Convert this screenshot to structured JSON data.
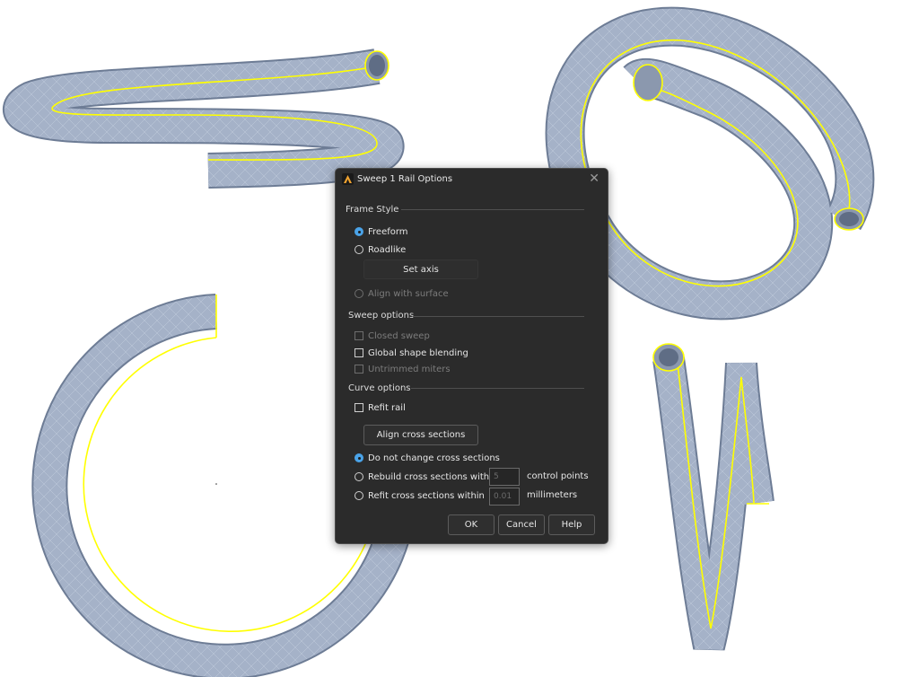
{
  "dialog": {
    "title": "Sweep 1 Rail Options",
    "close_glyph": "✕",
    "frame_style": {
      "heading": "Frame Style",
      "freeform": "Freeform",
      "roadlike": "Roadlike",
      "set_axis": "Set axis",
      "align_with_surface": "Align with surface"
    },
    "sweep_options": {
      "heading": "Sweep options",
      "closed_sweep": "Closed sweep",
      "global_shape_blending": "Global shape blending",
      "untrimmed_miters": "Untrimmed miters"
    },
    "curve_options": {
      "heading": "Curve options",
      "refit_rail": "Refit rail",
      "align_cross_sections": "Align cross sections",
      "do_not_change": "Do not change cross sections",
      "rebuild": "Rebuild cross sections with",
      "rebuild_value": "5",
      "rebuild_unit": "control points",
      "refit": "Refit cross sections within",
      "refit_value": "0.01",
      "refit_unit": "millimeters"
    },
    "buttons": {
      "ok": "OK",
      "cancel": "Cancel",
      "help": "Help"
    }
  },
  "colors": {
    "tube": "#a5b2c8",
    "tube_edge": "#6d7c95",
    "rail": "#ffff00",
    "accent": "#4aa3e8",
    "dialog_bg": "#2b2b2b"
  }
}
